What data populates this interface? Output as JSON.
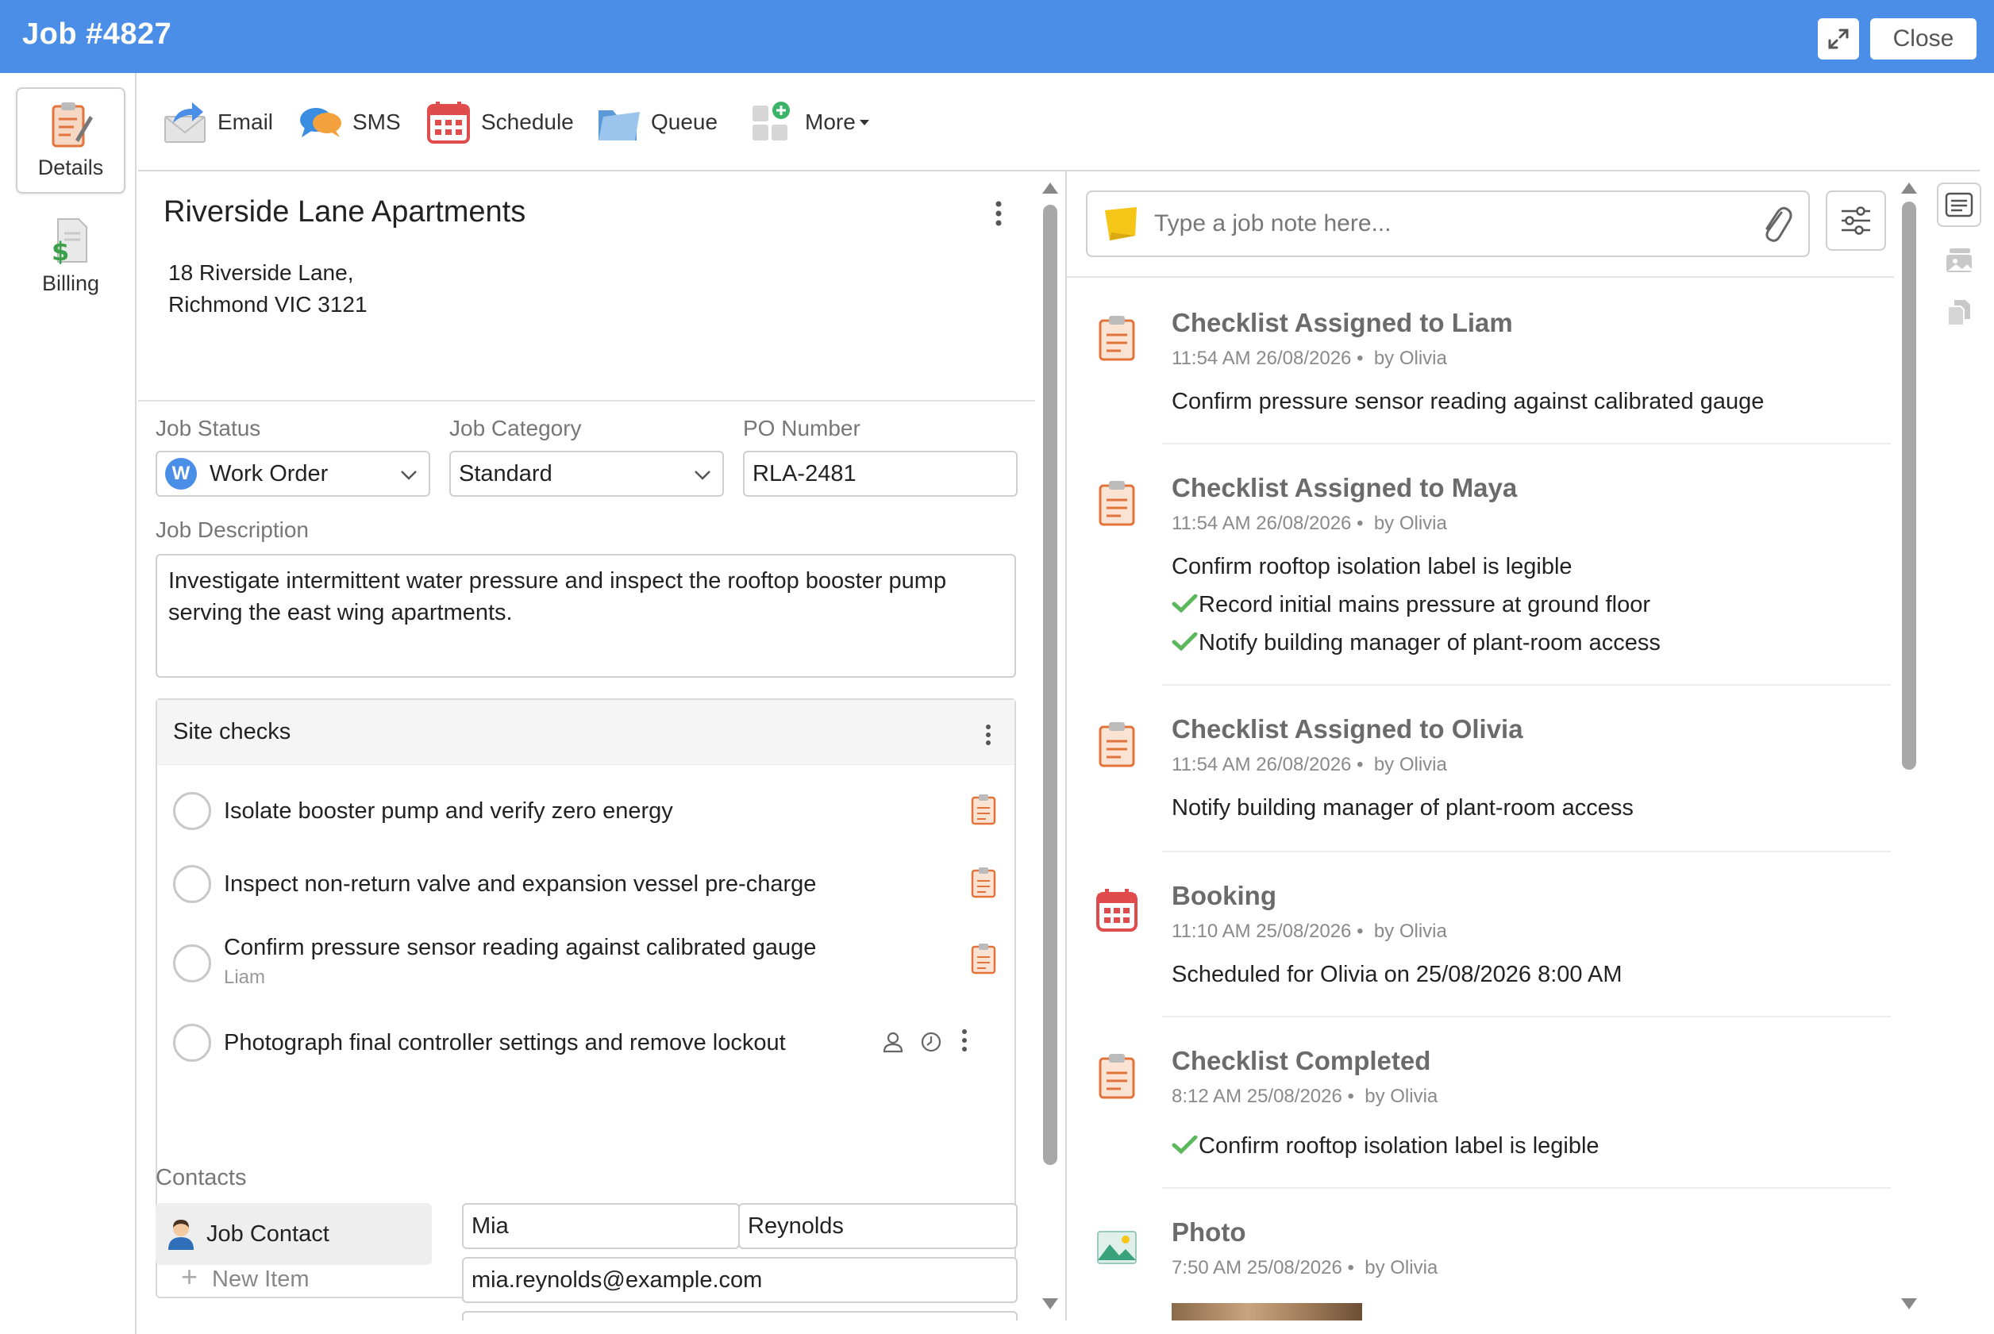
{
  "window": {
    "title": "Job #4827",
    "close_label": "Close"
  },
  "rail": {
    "details_label": "Details",
    "billing_label": "Billing"
  },
  "toolbar": {
    "email": "Email",
    "sms": "SMS",
    "schedule": "Schedule",
    "queue": "Queue",
    "more": "More"
  },
  "site": {
    "name": "Riverside Lane Apartments",
    "address_line1": "18 Riverside Lane,",
    "address_line2": "Richmond VIC 3121"
  },
  "fields": {
    "job_status_label": "Job Status",
    "job_status_badge": "W",
    "job_status_value": "Work Order",
    "job_category_label": "Job Category",
    "job_category_value": "Standard",
    "po_label": "PO Number",
    "po_value": "RLA-2481",
    "description_label": "Job Description",
    "description_value": "Investigate intermittent water pressure and inspect the rooftop booster pump serving the east wing apartments."
  },
  "checklist": {
    "title": "Site checks",
    "items": [
      {
        "text": "Isolate booster pump and verify zero energy",
        "assignee": ""
      },
      {
        "text": "Inspect non-return valve and expansion vessel pre-charge",
        "assignee": ""
      },
      {
        "text": "Confirm pressure sensor reading against calibrated gauge",
        "assignee": "Liam"
      },
      {
        "text": "Photograph final controller settings and remove lockout",
        "assignee": ""
      }
    ],
    "new_item_label": "New Item"
  },
  "contacts": {
    "label": "Contacts",
    "tag": "Job Contact",
    "first_name": "Mia",
    "last_name": "Reynolds",
    "email": "mia.reynolds@example.com"
  },
  "notes": {
    "placeholder": "Type a job note here..."
  },
  "feed": [
    {
      "icon": "checklist-icon",
      "title": "Checklist Assigned to Liam",
      "time": "11:54 AM 26/08/2026",
      "by": "by Olivia",
      "lines": [
        {
          "text": "Confirm pressure sensor reading against calibrated gauge",
          "checked": false
        }
      ]
    },
    {
      "icon": "checklist-icon",
      "title": "Checklist Assigned to Maya",
      "time": "11:54 AM 26/08/2026",
      "by": "by Olivia",
      "lines": [
        {
          "text": "Confirm rooftop isolation label is legible",
          "checked": false
        },
        {
          "text": "Record initial mains pressure at ground floor",
          "checked": true
        },
        {
          "text": "Notify building manager of plant-room access",
          "checked": true
        }
      ]
    },
    {
      "icon": "checklist-icon",
      "title": "Checklist Assigned to Olivia",
      "time": "11:54 AM 26/08/2026",
      "by": "by Olivia",
      "lines": [
        {
          "text": "Notify building manager of plant-room access",
          "checked": false
        }
      ]
    },
    {
      "icon": "calendar-icon",
      "title": "Booking",
      "time": "11:10 AM 25/08/2026",
      "by": "by Olivia",
      "lines": [
        {
          "text": "Scheduled for Olivia on 25/08/2026 8:00 AM",
          "checked": false
        }
      ]
    },
    {
      "icon": "checklist-icon",
      "title": "Checklist Completed",
      "time": "8:12 AM 25/08/2026",
      "by": "by Olivia",
      "lines": [
        {
          "text": "Confirm rooftop isolation label is legible",
          "checked": true
        }
      ]
    },
    {
      "icon": "photo-icon",
      "title": "Photo",
      "time": "7:50 AM 25/08/2026",
      "by": "by Olivia",
      "lines": []
    }
  ],
  "colors": {
    "header": "#4a8ee8",
    "check_green": "#5cb85c",
    "checklist_orange": "#e2733b",
    "calendar_red": "#e04b4b"
  }
}
